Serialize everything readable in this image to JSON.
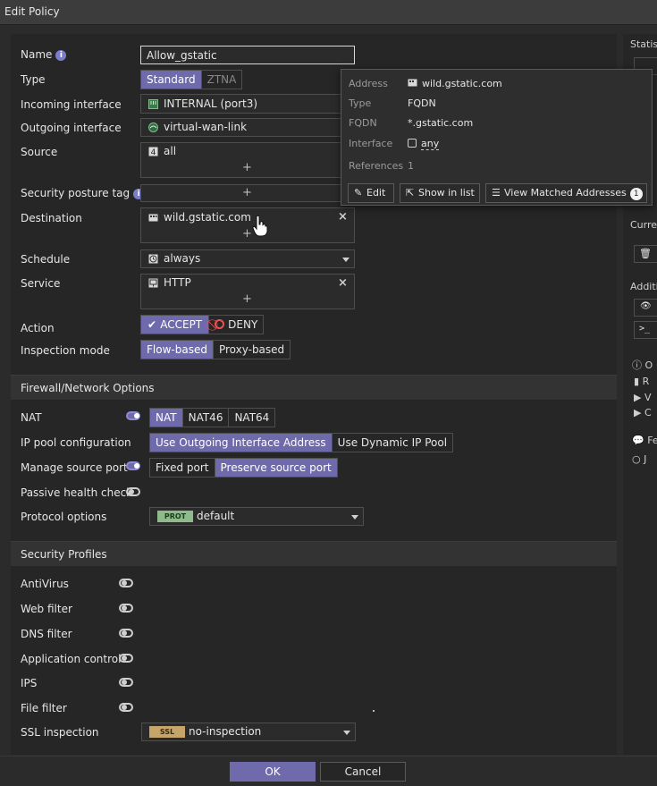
{
  "window": {
    "title": "Edit Policy"
  },
  "form": {
    "name_label": "Name",
    "name_value": "Allow_gstatic",
    "type_label": "Type",
    "type_options": [
      "Standard",
      "ZTNA"
    ],
    "incoming_label": "Incoming interface",
    "incoming_value": "INTERNAL (port3)",
    "outgoing_label": "Outgoing interface",
    "outgoing_value": "virtual-wan-link",
    "source_label": "Source",
    "source_value": "all",
    "posture_label": "Security posture tag",
    "destination_label": "Destination",
    "destination_value": "wild.gstatic.com",
    "schedule_label": "Schedule",
    "schedule_value": "always",
    "service_label": "Service",
    "service_value": "HTTP",
    "action_label": "Action",
    "action_accept": "ACCEPT",
    "action_deny": "DENY",
    "inspection_label": "Inspection mode",
    "inspection_options": [
      "Flow-based",
      "Proxy-based"
    ],
    "plus": "+",
    "remove": "×"
  },
  "firewall": {
    "section_title": "Firewall/Network Options",
    "nat_label": "NAT",
    "nat_options": [
      "NAT",
      "NAT46",
      "NAT64"
    ],
    "ippool_label": "IP pool configuration",
    "ippool_options": [
      "Use Outgoing Interface Address",
      "Use Dynamic IP Pool"
    ],
    "srcport_label": "Manage source port",
    "srcport_options": [
      "Fixed port",
      "Preserve source port"
    ],
    "health_label": "Passive health check",
    "protocol_label": "Protocol options",
    "protocol_tag": "PROT",
    "protocol_value": "default"
  },
  "profiles": {
    "section_title": "Security Profiles",
    "items": [
      "AntiVirus",
      "Web filter",
      "DNS filter",
      "Application control",
      "IPS",
      "File filter"
    ],
    "ssl_label": "SSL inspection",
    "ssl_tag": "SSL",
    "ssl_value": "no-inspection"
  },
  "popup": {
    "address_key": "Address",
    "address_value": "wild.gstatic.com",
    "type_key": "Type",
    "type_value": "FQDN",
    "fqdn_key": "FQDN",
    "fqdn_value": "*.gstatic.com",
    "interface_key": "Interface",
    "interface_value": "any",
    "references_key": "References",
    "references_value": "1",
    "edit_label": "Edit",
    "show_label": "Show in list",
    "matched_label": "View Matched Addresses",
    "matched_count": "1"
  },
  "right_panel": {
    "statistics": "Statis",
    "current": "Curre",
    "additional": "Additi",
    "items": [
      "O",
      "R",
      "V",
      "C",
      "Fe",
      "J"
    ]
  },
  "footer": {
    "ok_label": "OK",
    "cancel_label": "Cancel"
  },
  "colors": {
    "accent": "#6e6aab",
    "background": "#262626",
    "protocol_tag": "#8dbb8a",
    "ssl_tag": "#c7a56a"
  }
}
